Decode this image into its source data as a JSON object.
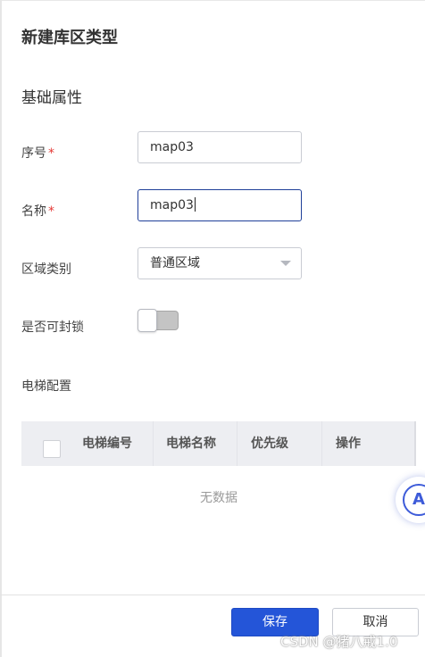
{
  "dialog": {
    "title": "新建库区类型",
    "section_basic": "基础属性"
  },
  "form": {
    "seq": {
      "label": "序号",
      "required_mark": "*",
      "value": "map03"
    },
    "name": {
      "label": "名称",
      "required_mark": "*",
      "value": "map03"
    },
    "zone_type": {
      "label": "区域类别",
      "value": "普通区域"
    },
    "lockable": {
      "label": "是否可封锁",
      "enabled": false
    }
  },
  "elevator": {
    "section_label": "电梯配置",
    "columns": [
      "电梯编号",
      "电梯名称",
      "优先级",
      "操作"
    ],
    "empty_text": "无数据"
  },
  "floating_assistant": {
    "glyph": "A"
  },
  "footer": {
    "save_label": "保存",
    "cancel_label": "取消"
  },
  "watermark": "CSDN @猪八戒1.0",
  "colors": {
    "primary": "#2455d8",
    "required": "#e53935",
    "focus_border": "#1f3f99",
    "table_header_bg": "#edeef2"
  }
}
